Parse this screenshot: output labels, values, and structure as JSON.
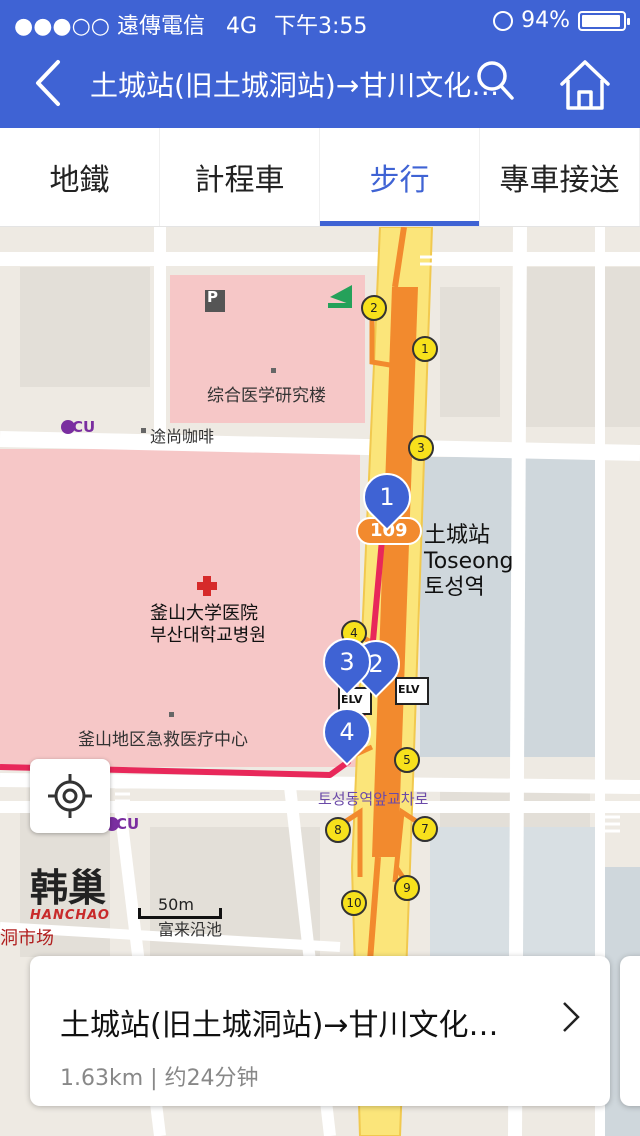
{
  "status": {
    "carrier": "●●●○○ 遠傳電信",
    "network": "4G",
    "time": "下午3:55",
    "battery": "94%"
  },
  "nav": {
    "title": "土城站(旧土城洞站)→甘川文化…"
  },
  "tabs": [
    {
      "label": "地鐵"
    },
    {
      "label": "計程車"
    },
    {
      "label": "步行"
    },
    {
      "label": "專車接送"
    }
  ],
  "active_tab": "步行",
  "map": {
    "labels": {
      "parking": "P",
      "medical_research": "综合医学研究楼",
      "cafe": "途尚咖啡",
      "cu": "CU",
      "station_number": "109",
      "station_cn": "土城站",
      "station_en": "Toseong",
      "station_kr": "토성역",
      "hospital_cn": "釜山大学医院",
      "hospital_kr": "부산대학교병원",
      "emergency": "釜山地区急救医疗中心",
      "intersection": "토성동역앞교차로",
      "elv": "ELV",
      "hanchao_cn": "韩巢",
      "hanchao_en": "HANCHAO",
      "market": "洞市场",
      "nearby": "富来沿池"
    },
    "exits": [
      "1",
      "2",
      "3",
      "4",
      "5",
      "7",
      "8",
      "9",
      "10"
    ],
    "waypoints": [
      "1",
      "2",
      "3",
      "4"
    ],
    "scale": "50m"
  },
  "card": {
    "title": "土城站(旧土城洞站)→甘川文化…",
    "distance": "1.63km",
    "duration": "约24分钟"
  },
  "colors": {
    "brand": "#3f63d4",
    "route": "#e8285a",
    "metro_line": "#f28a2e",
    "road_highlight": "#fbe57a",
    "hospital_block": "#f6c7c7"
  }
}
